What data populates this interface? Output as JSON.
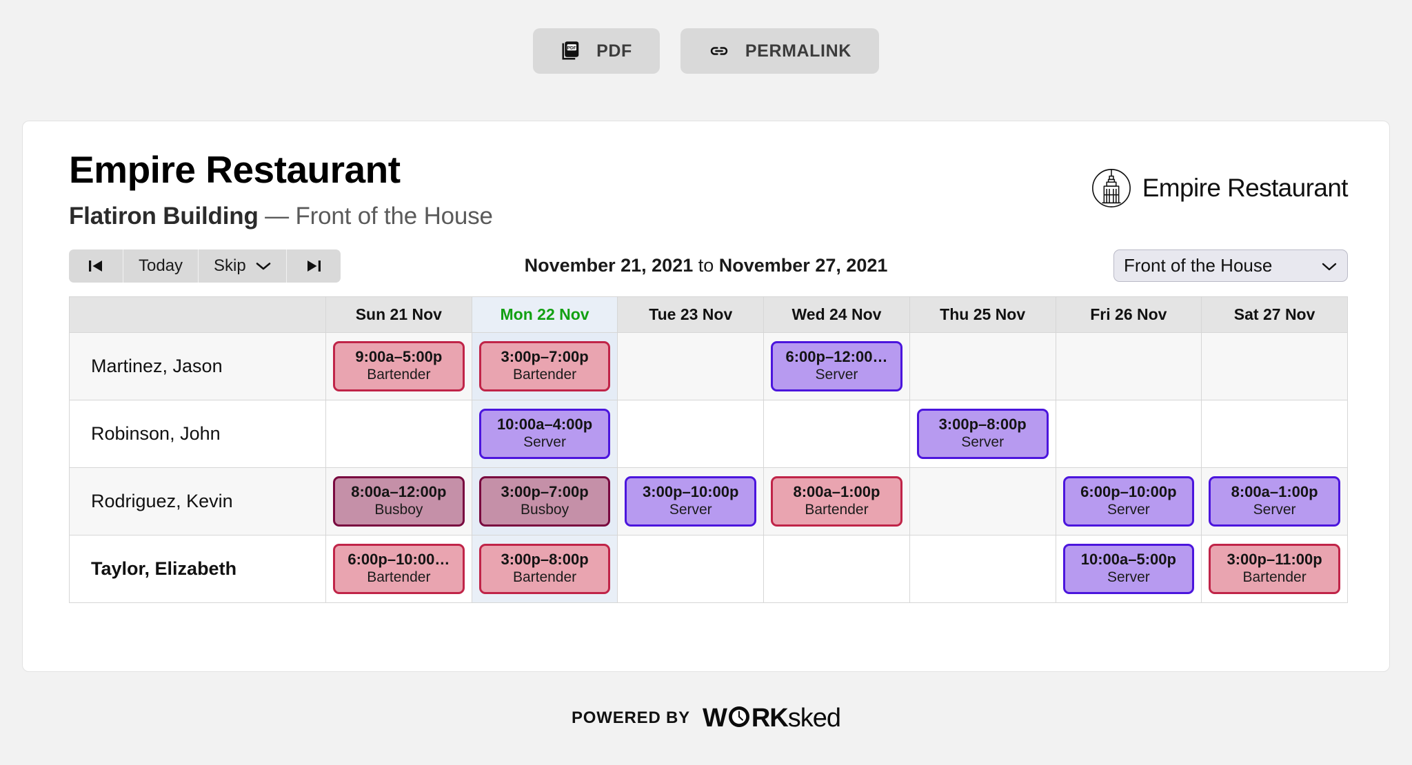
{
  "topbar": {
    "pdf_label": "PDF",
    "permalink_label": "PERMALINK"
  },
  "header": {
    "org_name": "Empire Restaurant",
    "location": "Flatiron Building",
    "separator": " — ",
    "department": "Front of the House",
    "logo_name": "Empire Restaurant"
  },
  "toolbar": {
    "first_label": "|◀",
    "today_label": "Today",
    "skip_label": "Skip",
    "last_label": "▶|",
    "range_start": "November 21, 2021",
    "range_conjunction": " to ",
    "range_end": "November 27, 2021",
    "department_selected": "Front of the House"
  },
  "schedule": {
    "name_column_header": "",
    "days": [
      {
        "label": "Sun 21 Nov",
        "today": false
      },
      {
        "label": "Mon 22 Nov",
        "today": true
      },
      {
        "label": "Tue 23 Nov",
        "today": false
      },
      {
        "label": "Wed 24 Nov",
        "today": false
      },
      {
        "label": "Thu 25 Nov",
        "today": false
      },
      {
        "label": "Fri 26 Nov",
        "today": false
      },
      {
        "label": "Sat 27 Nov",
        "today": false
      }
    ],
    "rows": [
      {
        "name": "Martinez, Jason",
        "bold": false,
        "shifts": [
          {
            "time": "9:00a–5:00p",
            "role": "Bartender"
          },
          {
            "time": "3:00p–7:00p",
            "role": "Bartender"
          },
          null,
          {
            "time": "6:00p–12:00…",
            "role": "Server"
          },
          null,
          null,
          null
        ]
      },
      {
        "name": "Robinson, John",
        "bold": false,
        "shifts": [
          null,
          {
            "time": "10:00a–4:00p",
            "role": "Server"
          },
          null,
          null,
          {
            "time": "3:00p–8:00p",
            "role": "Server"
          },
          null,
          null
        ]
      },
      {
        "name": "Rodriguez, Kevin",
        "bold": false,
        "shifts": [
          {
            "time": "8:00a–12:00p",
            "role": "Busboy"
          },
          {
            "time": "3:00p–7:00p",
            "role": "Busboy"
          },
          {
            "time": "3:00p–10:00p",
            "role": "Server"
          },
          {
            "time": "8:00a–1:00p",
            "role": "Bartender"
          },
          null,
          {
            "time": "6:00p–10:00p",
            "role": "Server"
          },
          {
            "time": "8:00a–1:00p",
            "role": "Server"
          }
        ]
      },
      {
        "name": "Taylor, Elizabeth",
        "bold": true,
        "shifts": [
          {
            "time": "6:00p–10:00…",
            "role": "Bartender"
          },
          {
            "time": "3:00p–8:00p",
            "role": "Bartender"
          },
          null,
          null,
          null,
          {
            "time": "10:00a–5:00p",
            "role": "Server"
          },
          {
            "time": "3:00p–11:00p",
            "role": "Bartender"
          }
        ]
      }
    ]
  },
  "footer": {
    "powered_by": "POWERED BY",
    "brand_bold": "W",
    "brand_bold2": "RK",
    "brand_light": "sked"
  },
  "colors": {
    "today_green": "#12a012",
    "bartender_fill": "#e9a4b0",
    "bartender_border": "#c02448",
    "server_fill": "#b79af0",
    "server_border": "#4b15dd",
    "busboy_fill": "#c590a8",
    "busboy_border": "#79093f",
    "today_column": "#e9eff7",
    "page_bg": "#f2f2f2"
  }
}
